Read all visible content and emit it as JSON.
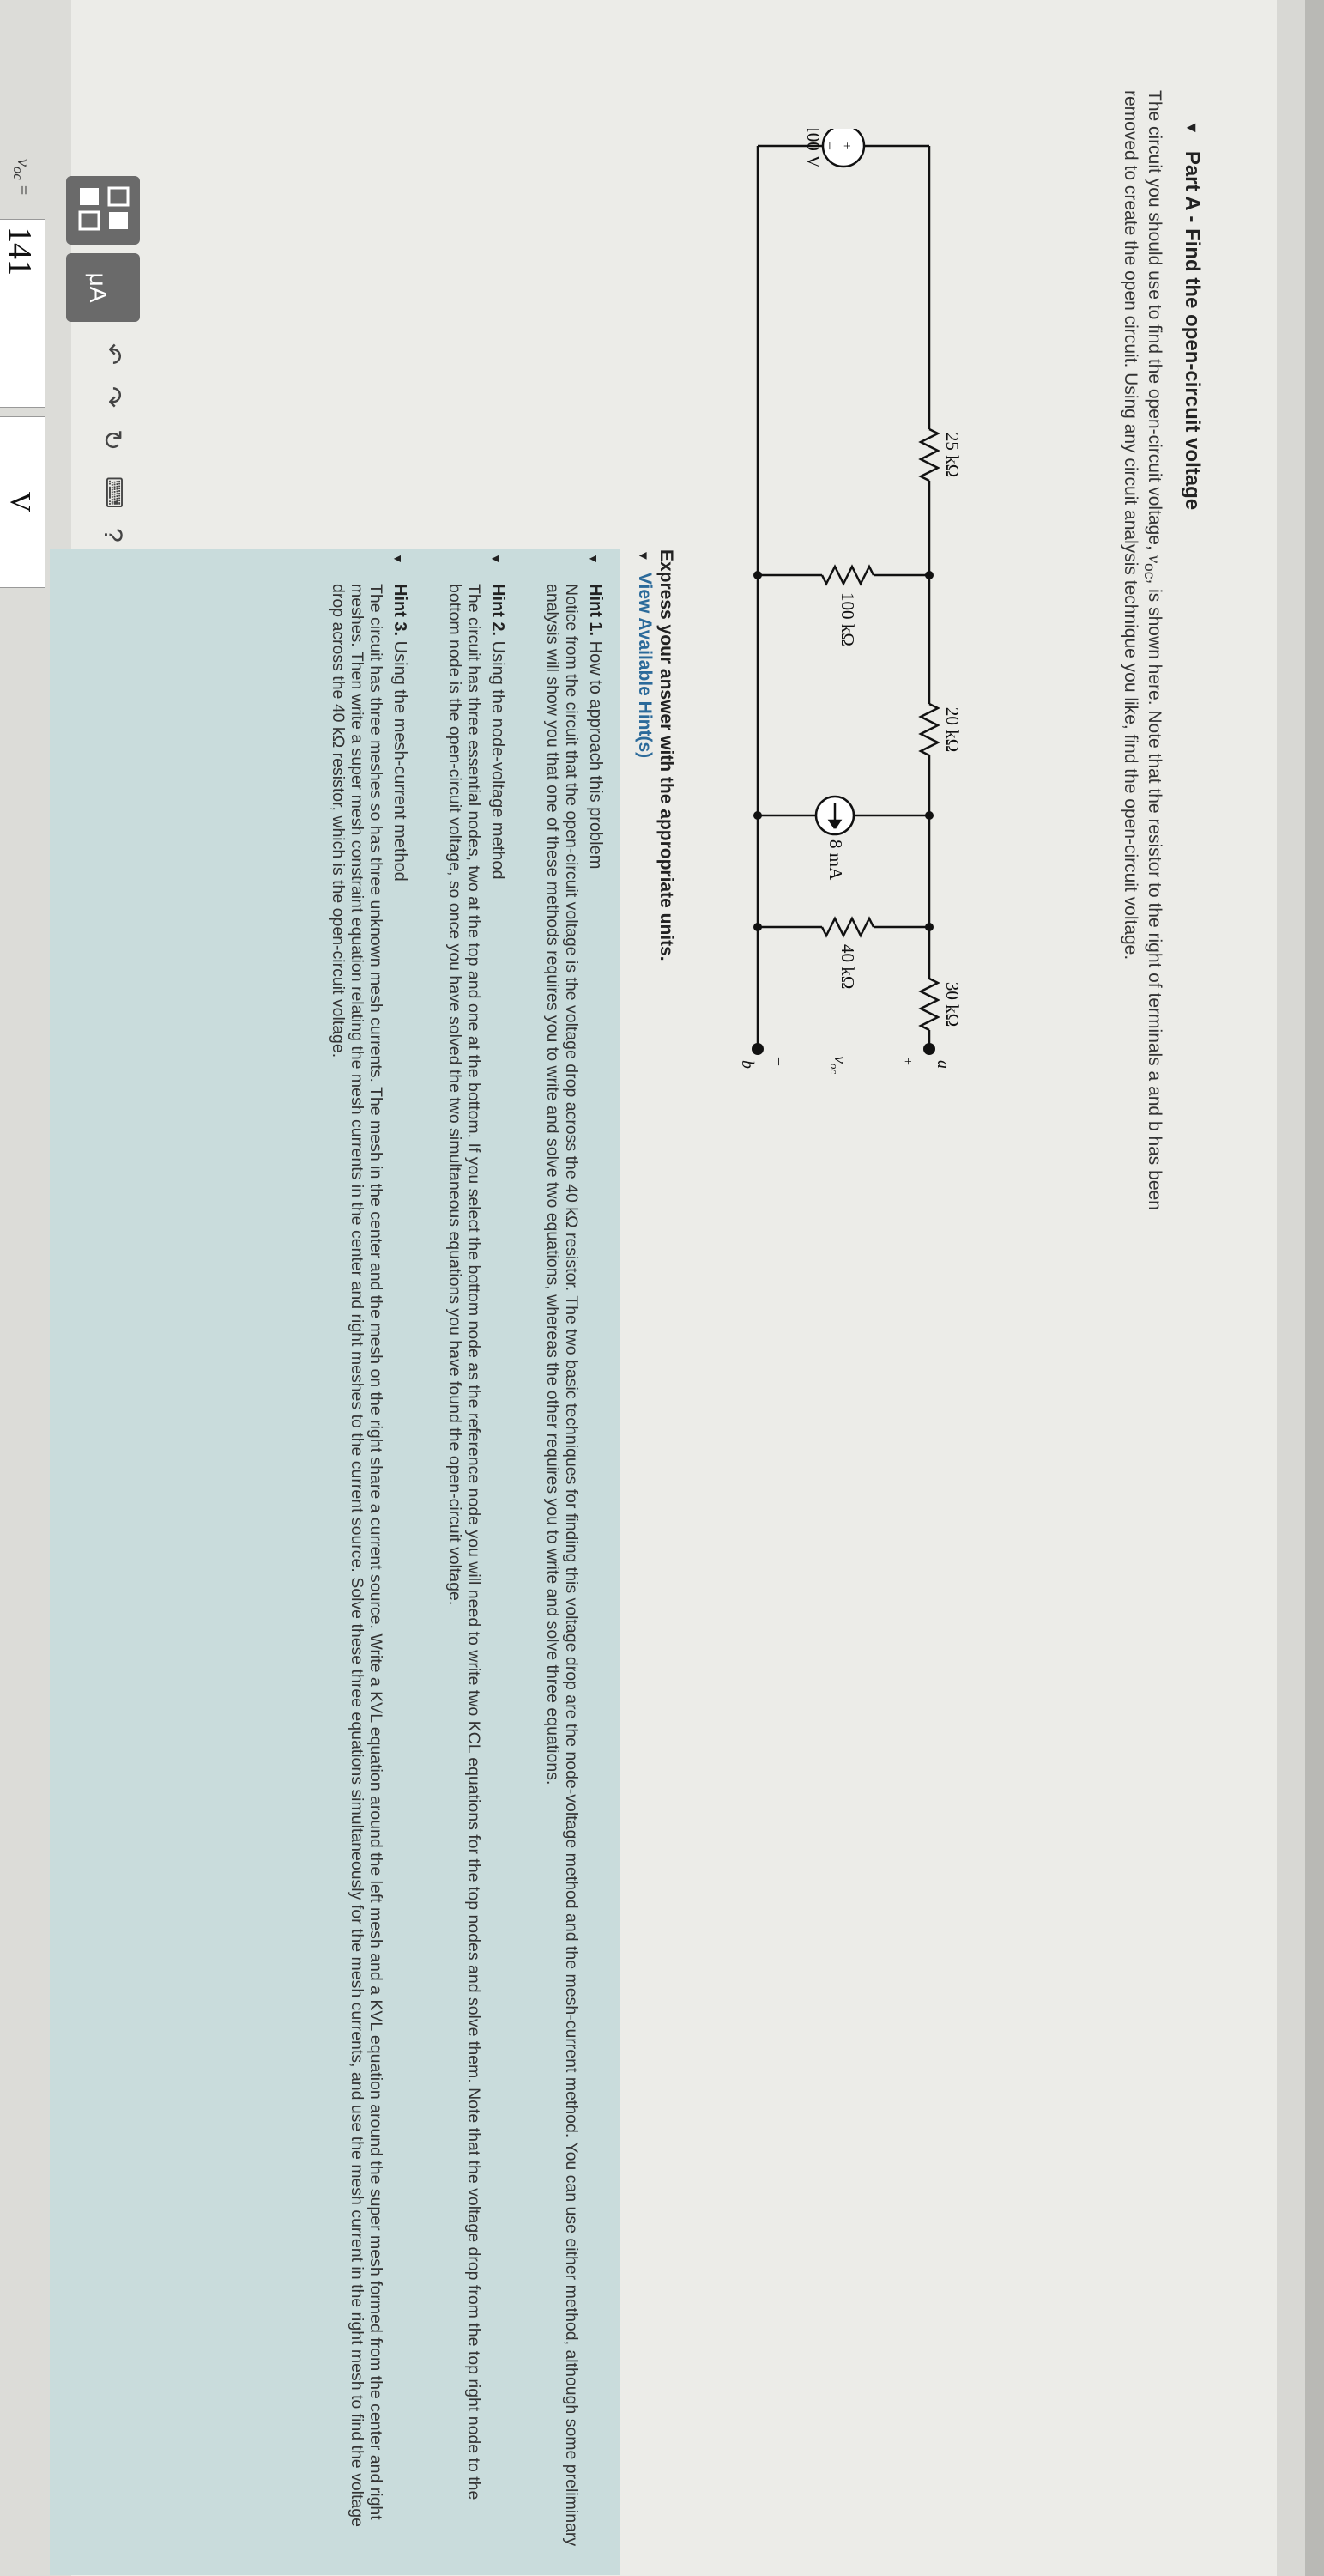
{
  "part": {
    "label": "Part A - Find the open-circuit voltage"
  },
  "problem": {
    "text_before": "The circuit you should use to find the open-circuit voltage, ",
    "symbol": "v",
    "symbol_sub": "oc",
    "text_after": ", is shown here. Note that the resistor to the right of terminals a and b has been removed to create the open circuit. Using any circuit analysis technique you like, find the open-circuit voltage."
  },
  "circuit": {
    "source_voltage": "100 V",
    "plus": "+",
    "minus": "–",
    "r1": "25 kΩ",
    "r2": "20 kΩ",
    "r3": "30 kΩ",
    "r4": "100 kΩ",
    "current_source": "8 mA",
    "r5": "40 kΩ",
    "terminal_a": "a",
    "terminal_b": "b",
    "voc": "v",
    "voc_sub": "oc",
    "plus_voc": "+",
    "minus_voc": "–"
  },
  "express": "Express your answer with the appropriate units.",
  "view_hints": "View Available Hint(s)",
  "hints": [
    {
      "label": "Hint 1.",
      "title": " How to approach this problem",
      "body": "Notice from the circuit that the open-circuit voltage is the voltage drop across the 40 kΩ resistor. The two basic techniques for finding this voltage drop are the node-voltage method and the mesh-current method. You can use either method, although some preliminary analysis will show you that one of these methods requires you to write and solve two equations, whereas the other requires you to write and solve three equations."
    },
    {
      "label": "Hint 2.",
      "title": " Using the node-voltage method",
      "body": "The circuit has three essential nodes, two at the top and one at the bottom. If you select the bottom node as the reference node you will need to write two KCL equations for the top nodes and solve them. Note that the voltage drop from the top right node to the bottom node is the open-circuit voltage, so once you have solved the two simultaneous equations you have found the open-circuit voltage."
    },
    {
      "label": "Hint 3.",
      "title": " Using the mesh-current method",
      "body": "The circuit has three meshes so has three unknown mesh currents. The mesh in the center and the mesh on the right share a current source. Write a KVL equation around the left mesh and a KVL equation around the super mesh formed from the center and right meshes. Then write a super mesh constraint equation relating the mesh currents in the center and right meshes to the current source. Solve these three equations simultaneously for the mesh currents, and use the mesh current in the right mesh to find the voltage drop across the 40 kΩ resistor, which is the open-circuit voltage."
    }
  ],
  "answer": {
    "label_v": "v",
    "label_sub": "oc",
    "label_eq": " =",
    "value": "141",
    "unit": "V",
    "help": "?"
  }
}
